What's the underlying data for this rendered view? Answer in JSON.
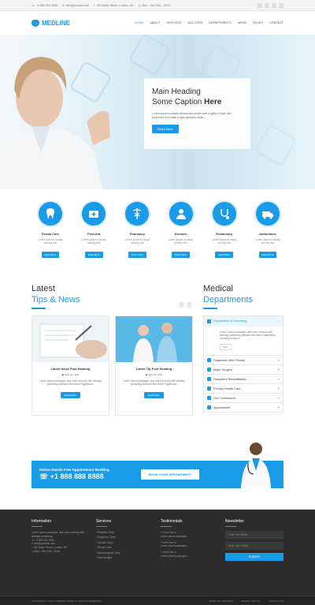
{
  "topbar": {
    "phone": "+1 800 000 0000",
    "email": "info@yoursite.com",
    "address": "220 Baker Street, London, UK",
    "hours": "Mon - Sat: 9:00 - 20:00"
  },
  "brand": {
    "name": "MEDLINE",
    "accent": "#1a9be8"
  },
  "nav": [
    "HOME",
    "ABOUT",
    "SERVICES",
    "DOCTORS",
    "DEPARTMENTS",
    "NEWS",
    "PAGES",
    "CONTACT"
  ],
  "hero": {
    "heading_line1": "Main Heading",
    "heading_line2_prefix": "Some Caption ",
    "heading_line2_bold": "Here",
    "text": "Lorem Ipsum is simply dummy text printer took a galley of type and scrambled it to make a type specimen book…",
    "button": "Read More"
  },
  "services": [
    {
      "title": "Dental Care",
      "text": "Lorem ipsum is simply dummy text",
      "button": "Read More",
      "icon": "tooth-icon"
    },
    {
      "title": "First Aid",
      "text": "Lorem ipsum is simply dummy text",
      "button": "Read More",
      "icon": "first-aid-icon"
    },
    {
      "title": "Pharmacy",
      "text": "Lorem ipsum is simply dummy text",
      "button": "Read More",
      "icon": "caduceus-icon"
    },
    {
      "title": "Doctors",
      "text": "Lorem ipsum is simply dummy text",
      "button": "Read More",
      "icon": "doctor-icon"
    },
    {
      "title": "Pulmonary",
      "text": "Lorem ipsum is simply dummy text",
      "button": "Read More",
      "icon": "stethoscope-icon"
    },
    {
      "title": "Ambulance",
      "text": "Lorem ipsum is simply dummy text",
      "button": "Read More",
      "icon": "ambulance-icon"
    }
  ],
  "tips": {
    "title_line1": "Latest",
    "title_line2": "Tips & News",
    "cards": [
      {
        "title": "Latest News Post Heading",
        "date": "Sept 21, 2021",
        "text": "Lorem Ipsum passages, and more recently with desktop publishing software like Aldus PageMaker.",
        "button": "Read More"
      },
      {
        "title": "Latest Tip Post Heading",
        "date": "Sept 15, 2021",
        "text": "Lorem Ipsum passages, and more recently with desktop publishing software like Aldus PageMaker.",
        "button": "Read More"
      }
    ]
  },
  "departments": {
    "title_line1": "Medical",
    "title_line2": "Departments",
    "open_item": "Department of Neurology",
    "open_text": "Lorem Ipsum passages, and more recently with desktop publishing software like Aldus PageMaker including versions.",
    "open_button": "More",
    "items": [
      "Diagnostic With Precise",
      "Major Surgery",
      "Outpatient Rehabilitation",
      "Primary Health Care",
      "24x7 Ambulance",
      "Appointment"
    ]
  },
  "banner": {
    "line1": "Online Hassle Free Appointment Booking",
    "line2": "+1 888 888 8888",
    "button": "BOOK YOUR APPOINTMENT"
  },
  "footer": {
    "info_title": "Information",
    "info_text": "Lorem Ipsum passages, and more recently with desktop publishing.",
    "info_phone": "+1 800 000 0000",
    "info_email": "info@yoursite.com",
    "info_address": "220 Baker Street, London, UK",
    "info_hours": "Mon - Sat: 9:00 - 20:00",
    "services_title": "Services",
    "services": [
      "Pediatric Clinic",
      "Diagnosis Clinic",
      "Cardiac Clinic",
      "Dental Clinic",
      "Gynecological Clinic",
      "Psychologist"
    ],
    "testimonials_title": "Testimonials",
    "testimonials": [
      {
        "name": "John Doe to",
        "quote": "Lorem ipsum passages..."
      },
      {
        "name": "John Doe to",
        "quote": "Lorem ipsum passages..."
      },
      {
        "name": "John Doe to",
        "quote": "Lorem ipsum passages..."
      }
    ],
    "newsletter_title": "Newsletter",
    "newsletter_name": "Enter Your Name",
    "newsletter_email": "Enter Your E-Mail",
    "newsletter_button": "SUBMIT",
    "copyright": "COPYRIGHT © 2021 COMPANY NAME ALL RIGHTS RESERVED",
    "links": [
      "TERMS OF SERVICES",
      "PRIVACY POLICY",
      "CONTACT US"
    ]
  }
}
